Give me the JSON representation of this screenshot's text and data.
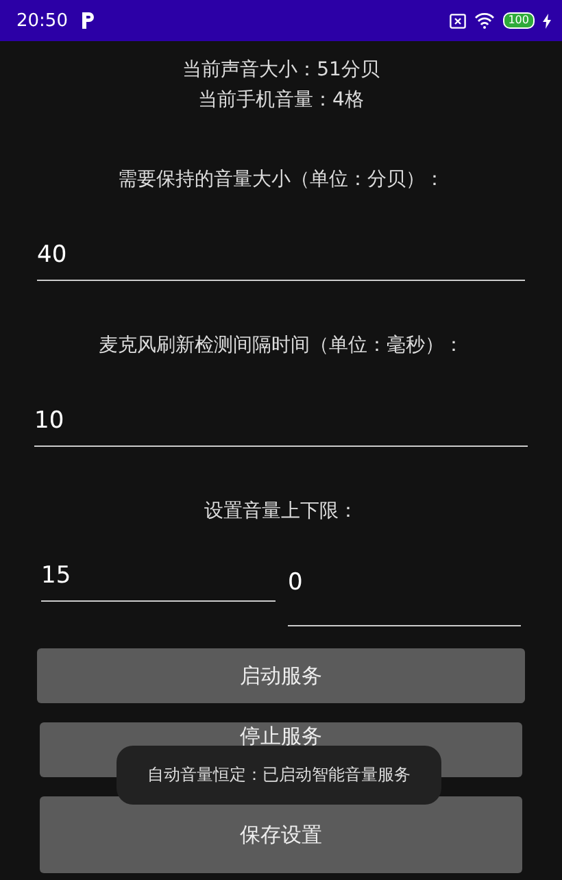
{
  "status_bar": {
    "time": "20:50",
    "battery": "100"
  },
  "readouts": [
    "当前声音大小：51分贝",
    "当前手机音量：4格"
  ],
  "fields": [
    {
      "label": "需要保持的音量大小（单位：分贝）：",
      "value": "40"
    },
    {
      "label": "麦克风刷新检测间隔时间（单位：毫秒）：",
      "value": "10"
    }
  ],
  "limits": {
    "label": "设置音量上下限：",
    "upper": "15",
    "lower": "0"
  },
  "buttons": [
    "启动服务",
    "停止服务",
    "保存设置"
  ],
  "toast": "自动音量恒定：已启动智能音量服务"
}
